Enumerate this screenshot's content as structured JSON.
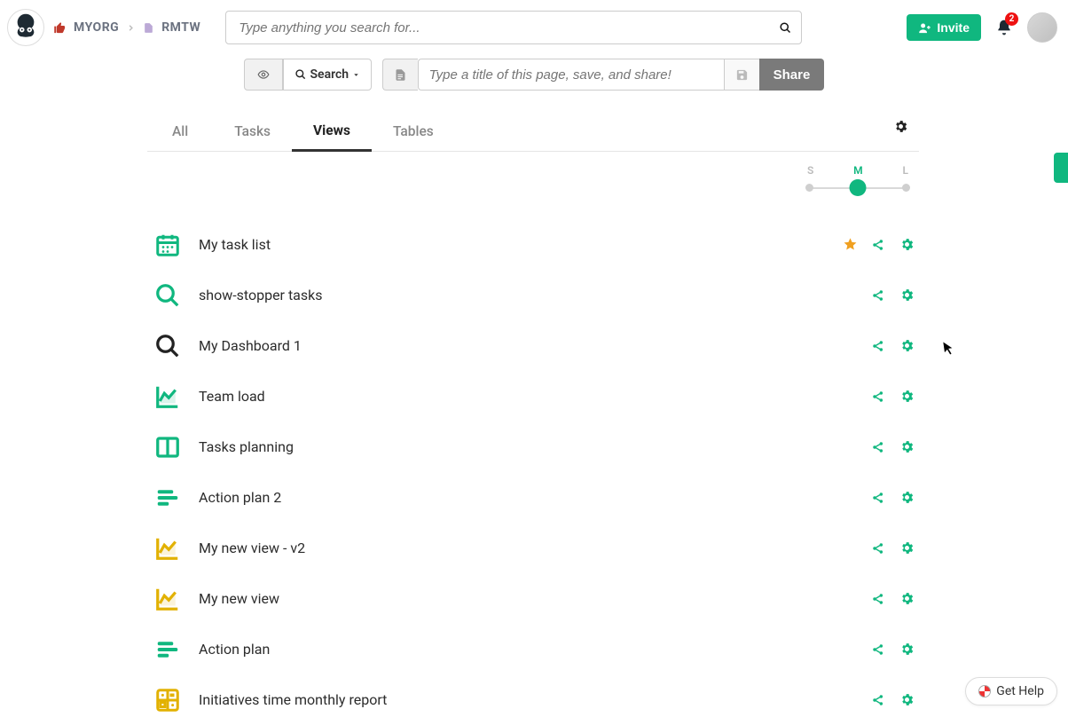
{
  "breadcrumb": {
    "org": "MYORG",
    "page": "RMTW"
  },
  "search": {
    "placeholder": "Type anything you search for..."
  },
  "invite": {
    "label": "Invite"
  },
  "notifications": {
    "count": "2"
  },
  "toolbar": {
    "search_label": "Search",
    "title_placeholder": "Type a title of this page, save, and share!",
    "share_label": "Share"
  },
  "tabs": {
    "items": [
      "All",
      "Tasks",
      "Views",
      "Tables"
    ],
    "active_index": 2
  },
  "size_slider": {
    "labels": [
      "S",
      "M",
      "L"
    ],
    "value": "M"
  },
  "views": [
    {
      "name": "My task list",
      "icon": "calendar",
      "icon_color": "#10b77f",
      "starred": true
    },
    {
      "name": "show-stopper tasks",
      "icon": "search",
      "icon_color": "#10b77f",
      "starred": false
    },
    {
      "name": "My Dashboard 1",
      "icon": "search",
      "icon_color": "#222222",
      "starred": false
    },
    {
      "name": "Team load",
      "icon": "chart",
      "icon_color": "#10b77f",
      "starred": false
    },
    {
      "name": "Tasks planning",
      "icon": "columns",
      "icon_color": "#10b77f",
      "starred": false
    },
    {
      "name": "Action plan 2",
      "icon": "bars",
      "icon_color": "#10b77f",
      "starred": false
    },
    {
      "name": "My new view - v2",
      "icon": "chart",
      "icon_color": "#e2b100",
      "starred": false
    },
    {
      "name": "My new view",
      "icon": "chart",
      "icon_color": "#e2b100",
      "starred": false
    },
    {
      "name": "Action plan",
      "icon": "bars",
      "icon_color": "#10b77f",
      "starred": false
    },
    {
      "name": "Initiatives time monthly report",
      "icon": "grid4",
      "icon_color": "#e2b100",
      "starred": false
    }
  ],
  "gethelp": {
    "label": "Get Help"
  }
}
